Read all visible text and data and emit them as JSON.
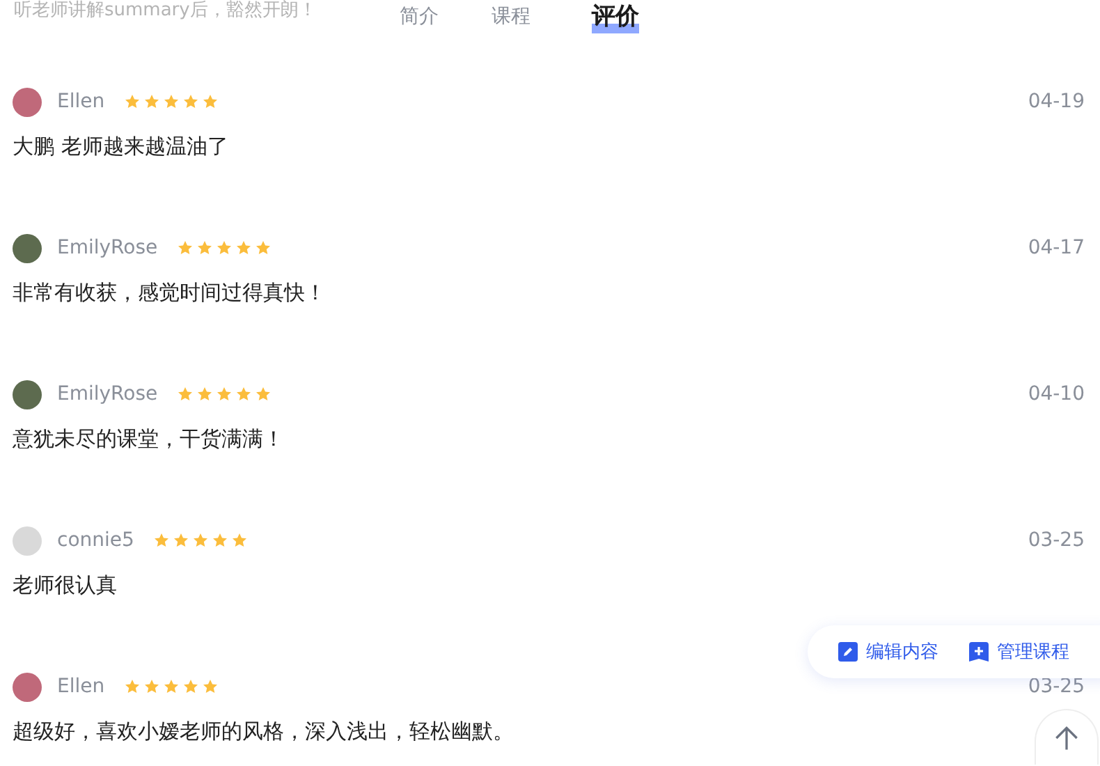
{
  "previous_comment": "听老师讲解summary后，豁然开朗！",
  "tabs": [
    {
      "label": "简介",
      "selected": false
    },
    {
      "label": "课程",
      "selected": false
    },
    {
      "label": "评价",
      "selected": true
    }
  ],
  "reviews": [
    {
      "user": "Ellen",
      "stars": 5,
      "date": "04-19",
      "text": "大鹏 老师越来越温油了"
    },
    {
      "user": "EmilyRose",
      "stars": 5,
      "date": "04-17",
      "text": "非常有收获，感觉时间过得真快！"
    },
    {
      "user": "EmilyRose",
      "stars": 5,
      "date": "04-10",
      "text": "意犹未尽的课堂，干货满满！"
    },
    {
      "user": "connie5",
      "stars": 5,
      "date": "03-25",
      "text": "老师很认真"
    },
    {
      "user": "Ellen",
      "stars": 5,
      "date": "03-25",
      "text": "超级好，喜欢小嫒老师的风格，深入浅出，轻松幽默。"
    }
  ],
  "actions": [
    {
      "kind": "edit",
      "label": "编辑内容"
    },
    {
      "kind": "add",
      "label": "管理课程"
    }
  ]
}
